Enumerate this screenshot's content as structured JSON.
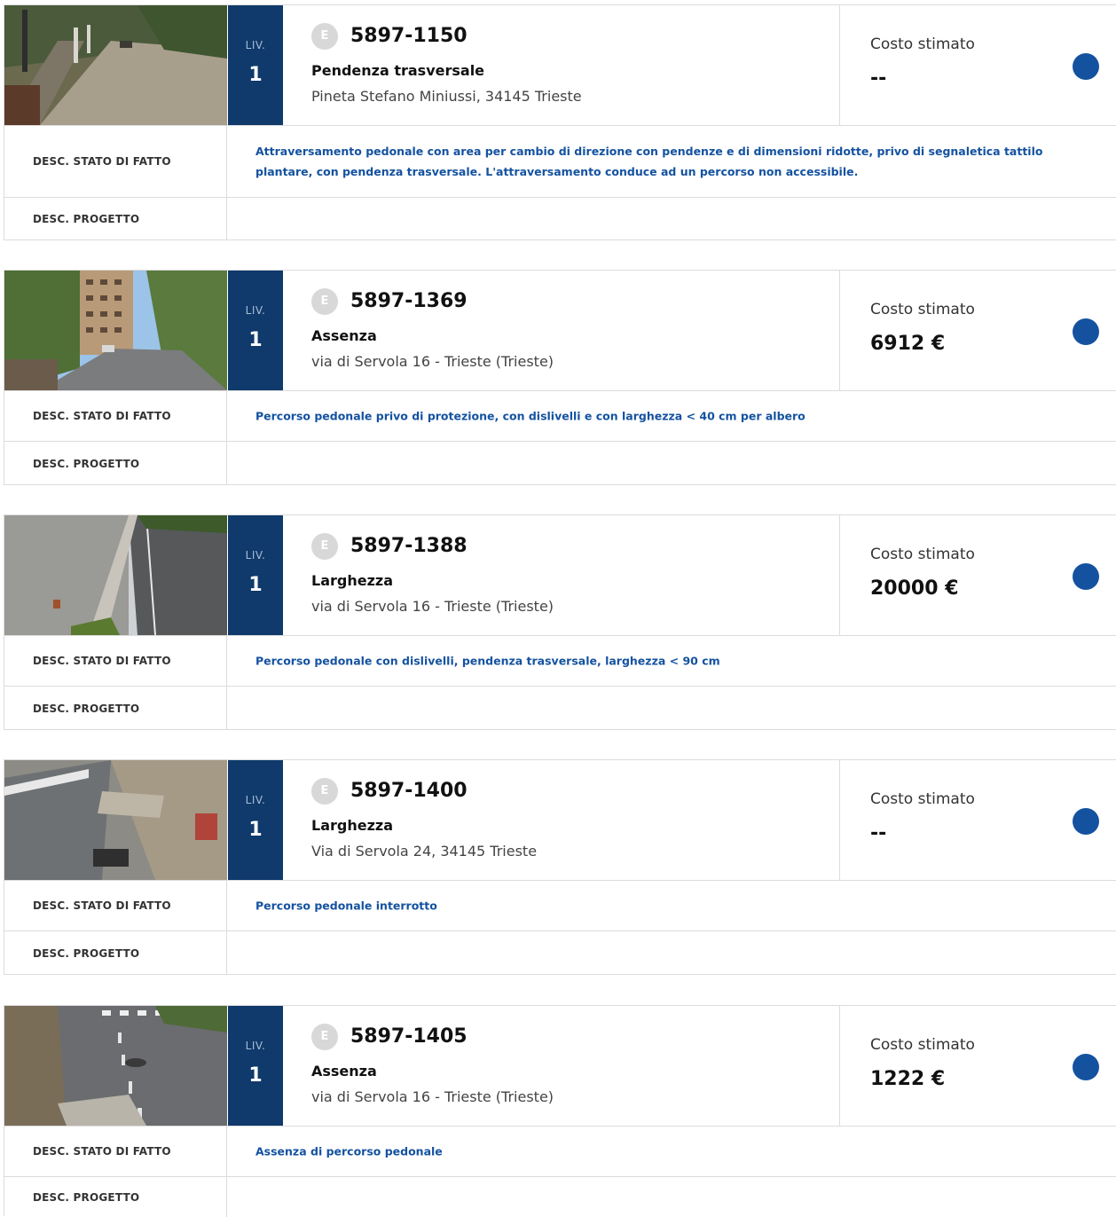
{
  "colors": {
    "level_bg": "#0f3a6b",
    "accent_dot": "#1452a0",
    "desc_text": "#1452a0",
    "badge": "#d8d8d8"
  },
  "labels": {
    "level": "LIV.",
    "cost": "Costo stimato",
    "desc_stato": "DESC. STATO DI FATTO",
    "desc_progetto": "DESC. PROGETTO",
    "badge_letter": "E"
  },
  "items": [
    {
      "photo": "sidewalk-with-bollards-photo",
      "level": "1",
      "code": "5897-1150",
      "subject": "Pendenza trasversale",
      "address": "Pineta Stefano Miniussi, 34145 Trieste",
      "cost": "--",
      "stato": "Attraversamento pedonale con area per cambio di direzione con pendenze e di dimensioni ridotte, privo di segnaletica tattilo plantare, con pendenza trasversale. L'attraversamento conduce ad un percorso non accessibile.",
      "progetto": ""
    },
    {
      "photo": "street-with-apartment-building-photo",
      "level": "1",
      "code": "5897-1369",
      "subject": "Assenza",
      "address": "via di Servola 16 - Trieste (Trieste)",
      "cost": "6912 €",
      "stato": "Percorso pedonale privo di protezione, con dislivelli e con larghezza < 40 cm per albero",
      "progetto": ""
    },
    {
      "photo": "narrow-curb-along-wall-photo",
      "level": "1",
      "code": "5897-1388",
      "subject": "Larghezza",
      "address": "via di Servola 16 - Trieste (Trieste)",
      "cost": "20000 €",
      "stato": "Percorso pedonale con dislivelli, pendenza trasversale, larghezza < 90 cm",
      "progetto": ""
    },
    {
      "photo": "interrupted-walkway-with-drain-photo",
      "level": "1",
      "code": "5897-1400",
      "subject": "Larghezza",
      "address": "Via di Servola 24, 34145 Trieste",
      "cost": "--",
      "stato": "Percorso pedonale interrotto",
      "progetto": ""
    },
    {
      "photo": "crosswalk-near-stone-wall-photo",
      "level": "1",
      "code": "5897-1405",
      "subject": "Assenza",
      "address": "via di Servola 16 - Trieste (Trieste)",
      "cost": "1222 €",
      "stato": "Assenza di percorso pedonale",
      "progetto": ""
    }
  ]
}
